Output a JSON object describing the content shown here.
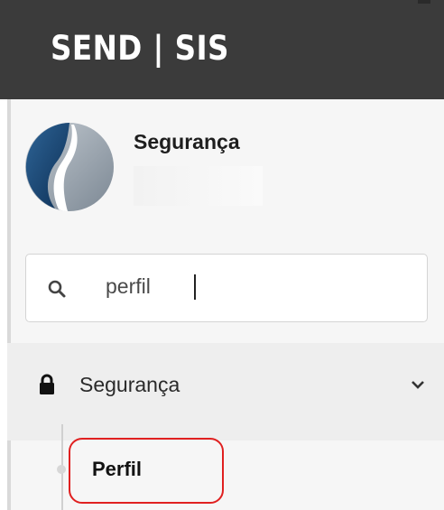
{
  "header": {
    "title": "SEND | SIS"
  },
  "profile": {
    "name": "Segurança"
  },
  "search": {
    "value": "perfil"
  },
  "menu": {
    "items": [
      {
        "label": "Segurança",
        "icon": "lock-icon",
        "expanded": true,
        "children": [
          {
            "label": "Perfil",
            "highlighted": true
          }
        ]
      }
    ]
  },
  "colors": {
    "header_bg": "#3b3b3b",
    "sidebar_bg": "#f6f6f6",
    "highlight": "#e02020"
  }
}
